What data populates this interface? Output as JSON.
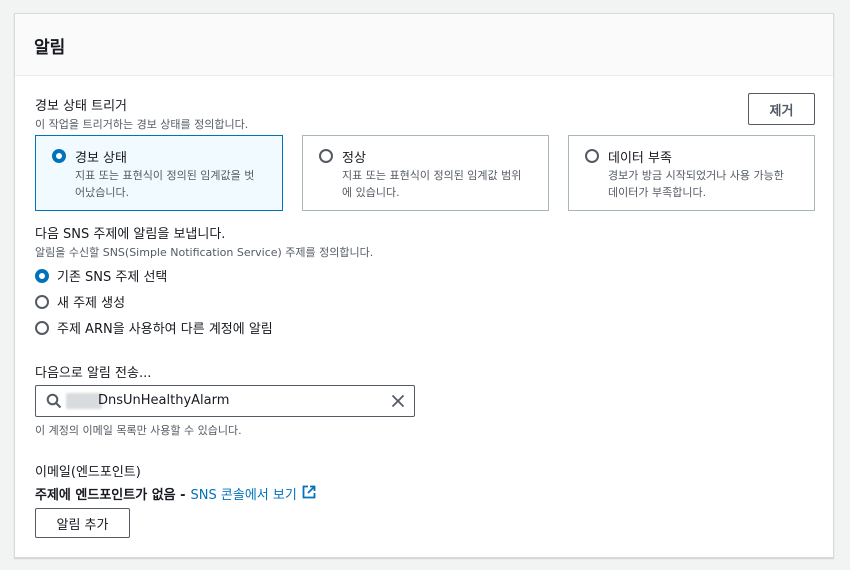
{
  "panel": {
    "title": "알림"
  },
  "trigger": {
    "label": "경보 상태 트리거",
    "description": "이 작업을 트리거하는 경보 상태를 정의합니다.",
    "remove_label": "제거",
    "tiles": [
      {
        "title": "경보 상태",
        "description": "지표 또는 표현식이 정의된 임계값을 벗어났습니다.",
        "selected": true
      },
      {
        "title": "정상",
        "description": "지표 또는 표현식이 정의된 임계값 범위에 있습니다.",
        "selected": false
      },
      {
        "title": "데이터 부족",
        "description": "경보가 방금 시작되었거나 사용 가능한 데이터가 부족합니다.",
        "selected": false
      }
    ]
  },
  "sns": {
    "label": "다음 SNS 주제에 알림을 보냅니다.",
    "description": "알림을 수신할 SNS(Simple Notification Service) 주제를 정의합니다.",
    "options": [
      {
        "label": "기존 SNS 주제 선택",
        "selected": true
      },
      {
        "label": "새 주제 생성",
        "selected": false
      },
      {
        "label": "주제 ARN을 사용하여 다른 계정에 알림",
        "selected": false
      }
    ]
  },
  "send_to": {
    "label": "다음으로 알림 전송...",
    "value": "DnsUnHealthyAlarm",
    "hint": "이 계정의 이메일 목록만 사용할 수 있습니다."
  },
  "email": {
    "label": "이메일(엔드포인트)",
    "no_endpoint": "주제에 엔드포인트가 없음 -",
    "link_text": "SNS 콘솔에서 보기"
  },
  "add_notification_label": "알림 추가",
  "colors": {
    "accent": "#0073bb",
    "text": "#16191f",
    "muted": "#545b64",
    "border": "#aab7b8"
  }
}
